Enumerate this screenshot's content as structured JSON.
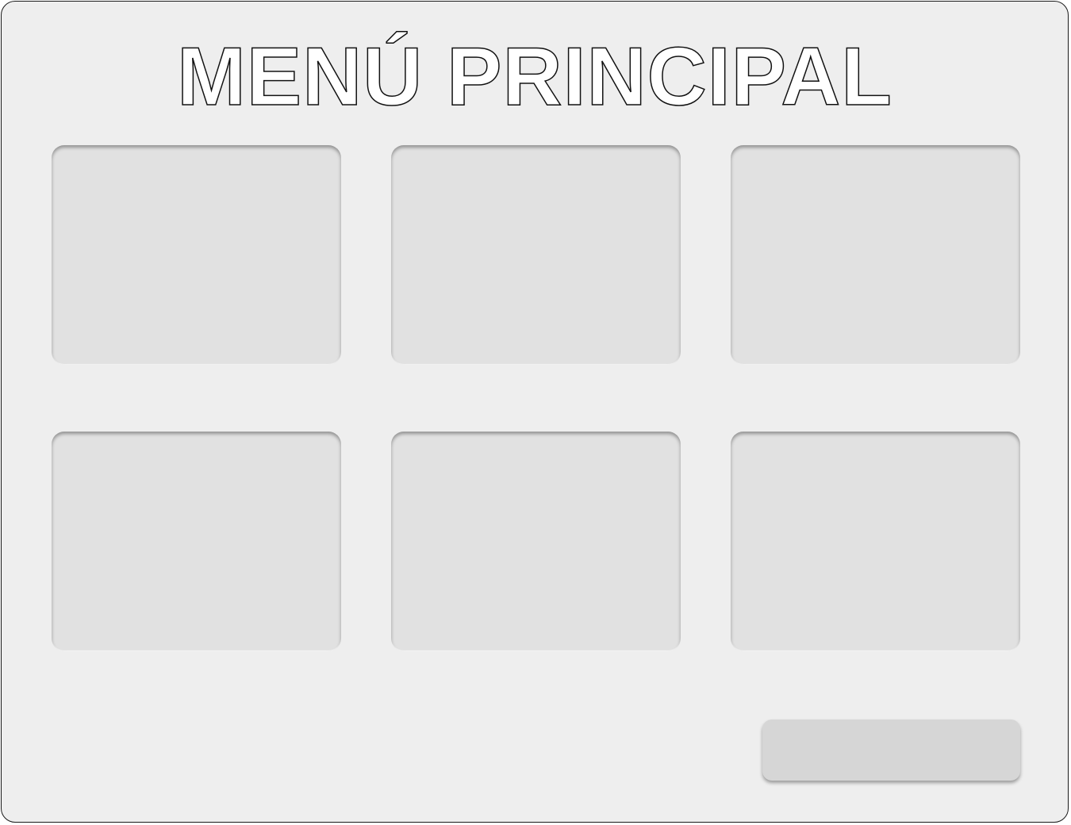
{
  "header": {
    "title": "MENÚ PRINCIPAL"
  },
  "menu": {
    "slots": [
      {
        "label": ""
      },
      {
        "label": ""
      },
      {
        "label": ""
      },
      {
        "label": ""
      },
      {
        "label": ""
      },
      {
        "label": ""
      }
    ]
  },
  "footer": {
    "action_label": ""
  },
  "colors": {
    "background": "#eeeeee",
    "slot": "#e1e1e1",
    "button": "#d6d6d6",
    "title_outline": "#111111"
  }
}
